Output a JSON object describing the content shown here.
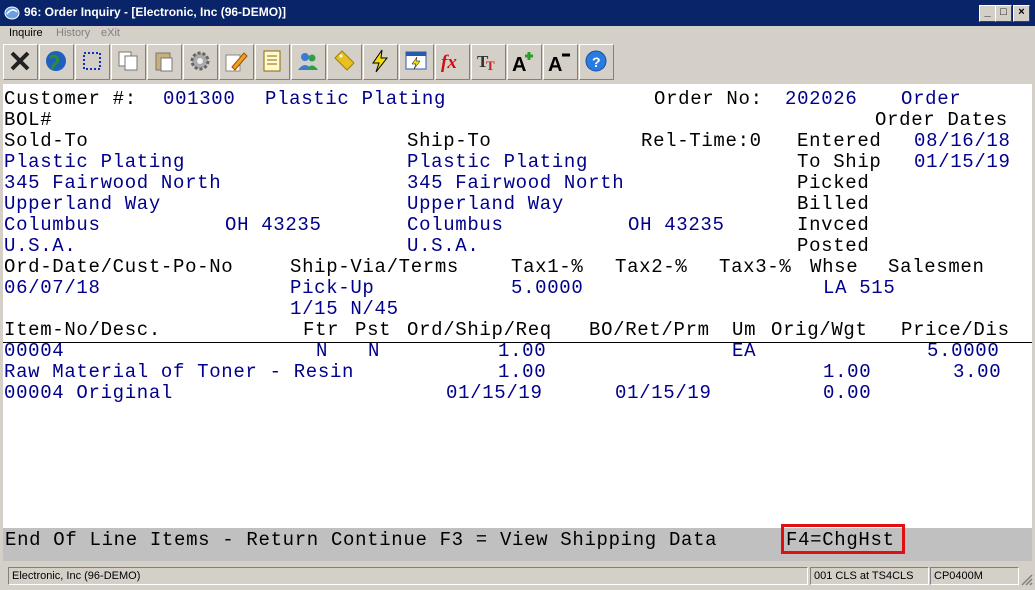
{
  "window": {
    "title": "96: Order Inquiry - [Electronic, Inc (96-DEMO)]",
    "minimize": "_",
    "maximize": "□",
    "close": "×"
  },
  "menu": [
    {
      "label": "Inquire",
      "enabled": true
    },
    {
      "label": "History",
      "enabled": false
    },
    {
      "label": "eXit",
      "enabled": false
    }
  ],
  "toolbar": [
    "close-x-icon",
    "globe-icon",
    "select-rect-icon",
    "copy-icon",
    "paste-icon",
    "settings-gear-icon",
    "edit-pencil-icon",
    "notepad-icon",
    "users-icon",
    "tag-icon",
    "lightning-icon",
    "run-script-icon",
    "function-fx-icon",
    "font-tt-icon",
    "font-increase-icon",
    "font-decrease-icon",
    "help-icon"
  ],
  "order": {
    "customer_label": "Customer #:",
    "customer_no": "001300",
    "customer_name": "Plastic Plating",
    "order_no_label": "Order No:",
    "order_no": "202026",
    "order_word": "Order",
    "bol_label": "BOL#",
    "order_dates_label": "Order Dates",
    "sold_to_label": "Sold-To",
    "ship_to_label": "Ship-To",
    "rel_time_label": "Rel-Time:0",
    "sold_to": {
      "name": "Plastic Plating",
      "addr1": "345 Fairwood North",
      "addr2": "Upperland Way",
      "city": "Columbus",
      "state_zip": "OH 43235",
      "country": "U.S.A."
    },
    "ship_to": {
      "name": "Plastic Plating",
      "addr1": "345 Fairwood North",
      "addr2": "Upperland Way",
      "city": "Columbus",
      "state_zip": "OH 43235",
      "country": "U.S.A."
    },
    "dates": {
      "entered_label": "Entered",
      "entered": "08/16/18",
      "to_ship_label": "To Ship",
      "to_ship": "01/15/19",
      "picked_label": "Picked",
      "billed_label": "Billed",
      "invced_label": "Invced",
      "posted_label": "Posted"
    },
    "hdr2": {
      "ord_date_po": "Ord-Date/Cust-Po-No",
      "ship_via_terms": "Ship-Via/Terms",
      "tax1": "Tax1-%",
      "tax2": "Tax2-%",
      "tax3": "Tax3-%",
      "whse": "Whse",
      "salesmen": "Salesmen"
    },
    "ord_date": "06/07/18",
    "ship_via": "Pick-Up",
    "terms": "1/15 N/45",
    "tax1_value": "5.0000",
    "whse_sales": "LA 515"
  },
  "items_header": {
    "item_desc": "Item-No/Desc.",
    "ftr": "Ftr",
    "pst": "Pst",
    "ord_ship_req": "Ord/Ship/Req",
    "bo_ret_prm": "BO/Ret/Prm",
    "um": "Um",
    "orig_wgt": "Orig/Wgt",
    "price_dis": "Price/Dis"
  },
  "line_items": [
    {
      "item_no": "00004",
      "ftr": "N",
      "pst": "N",
      "ord": "1.00",
      "um": "EA",
      "price": "5.0000",
      "desc": "Raw Material of Toner - Resin",
      "ship": "1.00",
      "orig": "1.00",
      "dis": "3.00",
      "orig_label": "00004 Original",
      "req": "01/15/19",
      "prm": "01/15/19",
      "wgt": "0.00"
    }
  ],
  "prompt": {
    "text": "End Of Line Items - Return Continue F3 = View Shipping Data ",
    "f4": "F4=ChgHst"
  },
  "status": {
    "company": "Electronic, Inc (96-DEMO)",
    "session": "001 CLS at TS4CLS",
    "program": "CP0400M"
  },
  "colors": {
    "field_value": "#00008b",
    "highlight": "#e01010",
    "titlebar": "#0a246a"
  }
}
